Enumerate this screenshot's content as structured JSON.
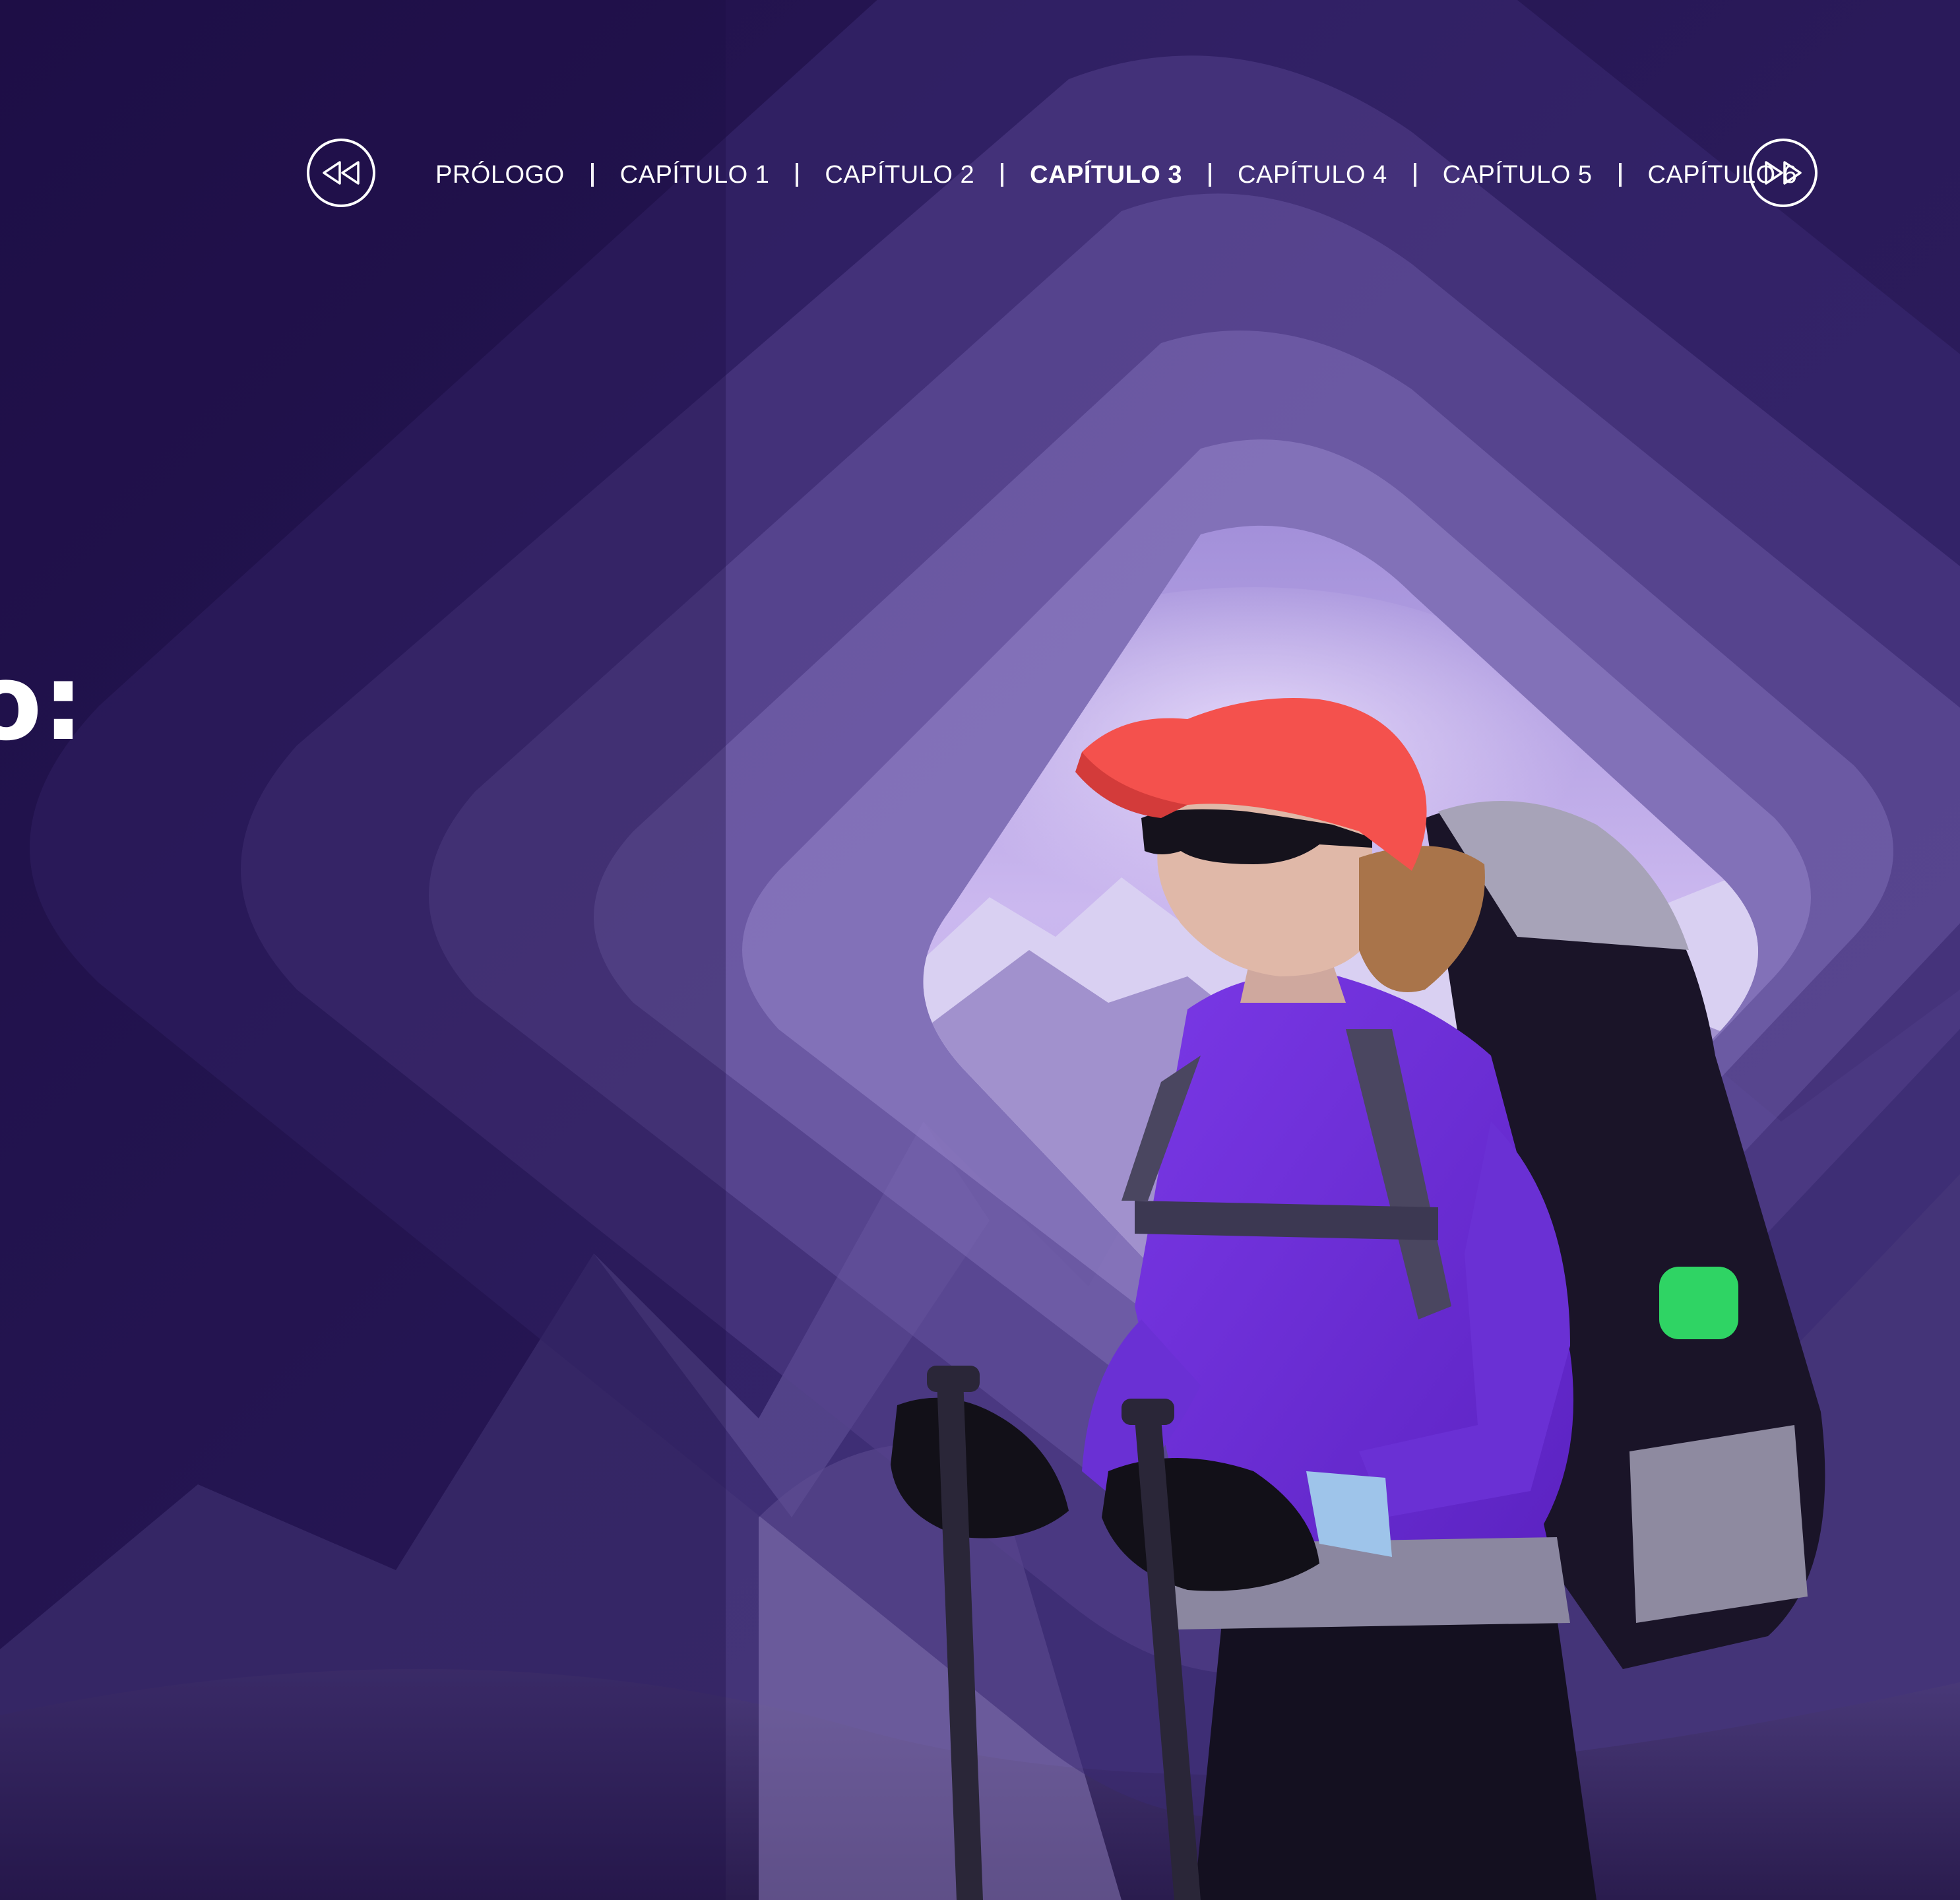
{
  "navigation": {
    "prev_icon": "rewind-icon",
    "next_icon": "fast-forward-icon",
    "chapters": [
      {
        "label": "PRÓLOGO",
        "active": false
      },
      {
        "label": "CAPÍTULO 1",
        "active": false
      },
      {
        "label": "CAPÍTULO 2",
        "active": false
      },
      {
        "label": "CAPÍTULO 3",
        "active": true
      },
      {
        "label": "CAPÍTULO 4",
        "active": false
      },
      {
        "label": "CAPÍTULO 5",
        "active": false
      },
      {
        "label": "CAPÍTULO 6",
        "active": false
      }
    ]
  },
  "headline": {
    "fragment": "o:"
  },
  "colors": {
    "background": "#1e0e46",
    "nav_text": "#ffffff",
    "cap_accent": "#f4514d",
    "bottle_accent": "#2fd464"
  }
}
